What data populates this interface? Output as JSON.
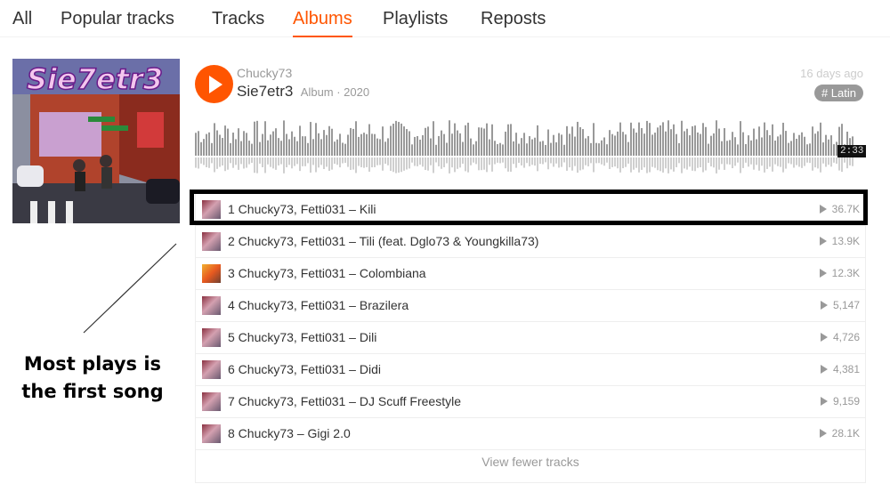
{
  "tabs": [
    {
      "label": "All",
      "active": false
    },
    {
      "label": "Popular tracks",
      "active": false
    },
    {
      "label": "Tracks",
      "active": false
    },
    {
      "label": "Albums",
      "active": true
    },
    {
      "label": "Playlists",
      "active": false
    },
    {
      "label": "Reposts",
      "active": false
    }
  ],
  "album": {
    "artist": "Chucky73",
    "title": "Sie7etr3",
    "meta": "Album · 2020",
    "posted": "16 days ago",
    "tag": "# Latin",
    "duration": "2:33",
    "cover_text": "Sie7etr3"
  },
  "tracks": [
    {
      "label": "1 Chucky73, Fetti031 – Kili",
      "plays": "36.7K"
    },
    {
      "label": "2 Chucky73, Fetti031 – Tili (feat. Dglo73 & Youngkilla73)",
      "plays": "13.9K"
    },
    {
      "label": "3 Chucky73, Fetti031 – Colombiana",
      "plays": "12.3K"
    },
    {
      "label": "4 Chucky73, Fetti031 – Brazilera",
      "plays": "5,147"
    },
    {
      "label": "5 Chucky73, Fetti031 – Dili",
      "plays": "4,726"
    },
    {
      "label": "6 Chucky73, Fetti031 – Didi",
      "plays": "4,381"
    },
    {
      "label": "7 Chucky73, Fetti031 – DJ Scuff Freestyle",
      "plays": "9,159"
    },
    {
      "label": "8 Chucky73 – Gigi 2.0",
      "plays": "28.1K"
    }
  ],
  "view_fewer": "View fewer tracks",
  "annotation": {
    "line1": "Most plays is",
    "line2": "the first song"
  },
  "colors": {
    "accent": "#ff5500",
    "text": "#333333",
    "muted": "#999999"
  },
  "icons": {
    "play": "play-icon",
    "tag": "hashtag"
  }
}
